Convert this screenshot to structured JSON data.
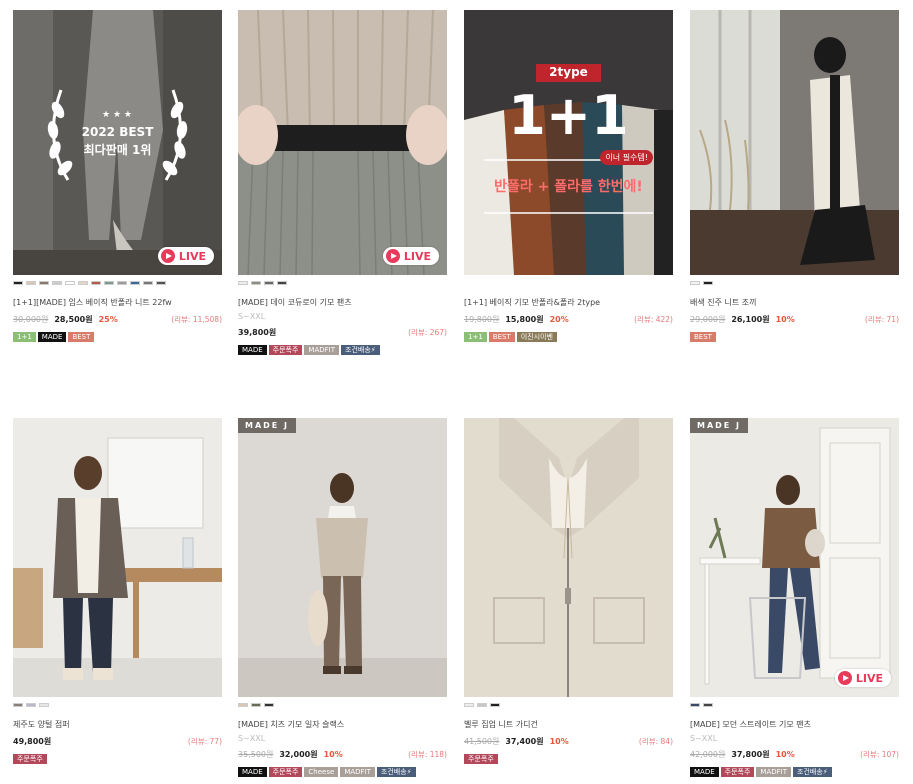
{
  "products": [
    {
      "name": "[1+1][MADE] 임스 베이직 반폴라 니트 22fw",
      "size": "",
      "original_price": "30,000원",
      "price": "28,500원",
      "discount": "25%",
      "review": "(리뷰: 11,508)",
      "live_label": "LIVE",
      "overlay_award": "2022 BEST",
      "overlay_award_sub": "최다판매 1위",
      "swatches": [
        "#222222",
        "#d9c6b5",
        "#8a7868",
        "#cccccc",
        "#ffffff",
        "#e3d7c6",
        "#b55a4a",
        "#7c9a8f",
        "#9b9b9b",
        "#3c6b9a",
        "#777777",
        "#555555"
      ],
      "badges": [
        {
          "label": "1+1",
          "color": "#8bbf76"
        },
        {
          "label": "MADE",
          "color": "#111111"
        },
        {
          "label": "BEST",
          "color": "#d97b69"
        }
      ]
    },
    {
      "name": "[MADE] 데이 코듀로이 기모 팬츠",
      "size": "S~XXL",
      "original_price": "",
      "price": "39,800원",
      "discount": "",
      "review": "(리뷰: 267)",
      "live_label": "LIVE",
      "swatches": [
        "#eeeeee",
        "#8c8c80",
        "#6a6a6a",
        "#444444"
      ],
      "badges": [
        {
          "label": "MADE",
          "color": "#111111"
        },
        {
          "label": "주문폭주",
          "color": "#b3485b"
        },
        {
          "label": "MADFIT",
          "color": "#a89f98"
        },
        {
          "label": "조건배송⚡",
          "color": "#4a5d7a"
        }
      ]
    },
    {
      "name": "[1+1] 베이직 기모 반폴라&폴라 2type",
      "size": "",
      "original_price": "19,800원",
      "price": "15,800원",
      "discount": "20%",
      "review": "(리뷰: 422)",
      "overlay_type": "2type",
      "overlay_main": "1+1",
      "overlay_tag": "이너 필수템!",
      "overlay_text": "반폴라 + 폴라를 한번에!",
      "swatches": [],
      "badges": [
        {
          "label": "1+1",
          "color": "#8bbf76"
        },
        {
          "label": "BEST",
          "color": "#d97b69"
        },
        {
          "label": "이진시이벤",
          "color": "#8a7a5a"
        }
      ]
    },
    {
      "name": "배색 진주 니트 조끼",
      "size": "",
      "original_price": "29,000원",
      "price": "26,100원",
      "discount": "10%",
      "review": "(리뷰: 71)",
      "swatches": [
        "#f2f2f2",
        "#222222"
      ],
      "badges": [
        {
          "label": "BEST",
          "color": "#d97b69"
        }
      ]
    },
    {
      "name": "제주도 양털 점퍼",
      "size": "",
      "original_price": "",
      "price": "49,800원",
      "discount": "",
      "review": "(리뷰: 77)",
      "swatches": [
        "#8a7f76",
        "#b8b8c8",
        "#e6e6e6"
      ],
      "badges": [
        {
          "label": "주문폭주",
          "color": "#b3485b"
        }
      ]
    },
    {
      "name": "[MADE] 치즈 기모 일자 슬랙스",
      "size": "S~XXL",
      "original_price": "35,500원",
      "price": "32,000원",
      "discount": "10%",
      "review": "(리뷰: 118)",
      "brand_tag": "MADE J",
      "swatches": [
        "#d9c6b5",
        "#6b6b55",
        "#333333"
      ],
      "badges": [
        {
          "label": "MADE",
          "color": "#111111"
        },
        {
          "label": "주문폭주",
          "color": "#b3485b"
        },
        {
          "label": "Cheese",
          "color": "#a89f98"
        },
        {
          "label": "MADFIT",
          "color": "#a89f98"
        },
        {
          "label": "조건배송⚡",
          "color": "#4a5d7a"
        }
      ]
    },
    {
      "name": "벨루 집업 니트 가디건",
      "size": "",
      "original_price": "41,500원",
      "price": "37,400원",
      "discount": "10%",
      "review": "(리뷰: 84)",
      "swatches": [
        "#eeeeee",
        "#c8c8c8",
        "#222222"
      ],
      "badges": [
        {
          "label": "주문폭주",
          "color": "#b3485b"
        }
      ]
    },
    {
      "name": "[MADE] 모던 스트레이트 기모 팬츠",
      "size": "S~XXL",
      "original_price": "42,000원",
      "price": "37,800원",
      "discount": "10%",
      "review": "(리뷰: 107)",
      "brand_tag": "MADE J",
      "live_label": "LIVE",
      "swatches": [
        "#3a4a6a",
        "#444444"
      ],
      "badges": [
        {
          "label": "MADE",
          "color": "#111111"
        },
        {
          "label": "주문폭주",
          "color": "#b3485b"
        },
        {
          "label": "MADFIT",
          "color": "#a89f98"
        },
        {
          "label": "조건배송⚡",
          "color": "#4a5d7a"
        }
      ]
    }
  ]
}
